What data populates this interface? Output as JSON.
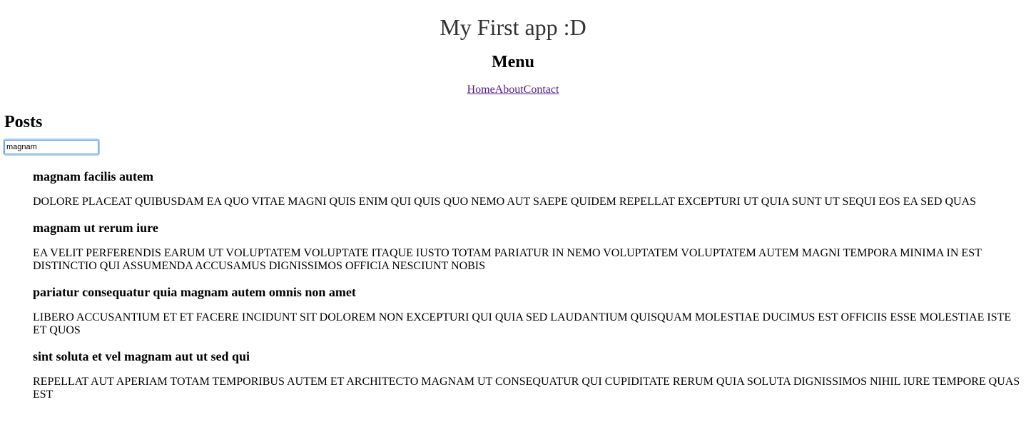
{
  "header": {
    "title": "My First app :D"
  },
  "menu": {
    "heading": "Menu",
    "links": [
      "Home",
      "About",
      "Contact"
    ]
  },
  "posts": {
    "heading": "Posts",
    "search": {
      "value": "magnam"
    },
    "items": [
      {
        "title": "magnam facilis autem",
        "body": "dolore placeat quibusdam ea quo vitae magni quis enim qui quis quo nemo aut saepe quidem repellat excepturi ut quia sunt ut sequi eos ea sed quas"
      },
      {
        "title": "magnam ut rerum iure",
        "body": "ea velit perferendis earum ut voluptatem voluptate itaque iusto totam pariatur in nemo voluptatem voluptatem autem magni tempora minima in est distinctio qui assumenda accusamus dignissimos officia nesciunt nobis"
      },
      {
        "title": "pariatur consequatur quia magnam autem omnis non amet",
        "body": "libero accusantium et et facere incidunt sit dolorem non excepturi qui quia sed laudantium quisquam molestiae ducimus est officiis esse molestiae iste et quos"
      },
      {
        "title": "sint soluta et vel magnam aut ut sed qui",
        "body": "repellat aut aperiam totam temporibus autem et architecto magnam ut consequatur qui cupiditate rerum quia soluta dignissimos nihil iure tempore quas est"
      }
    ]
  }
}
